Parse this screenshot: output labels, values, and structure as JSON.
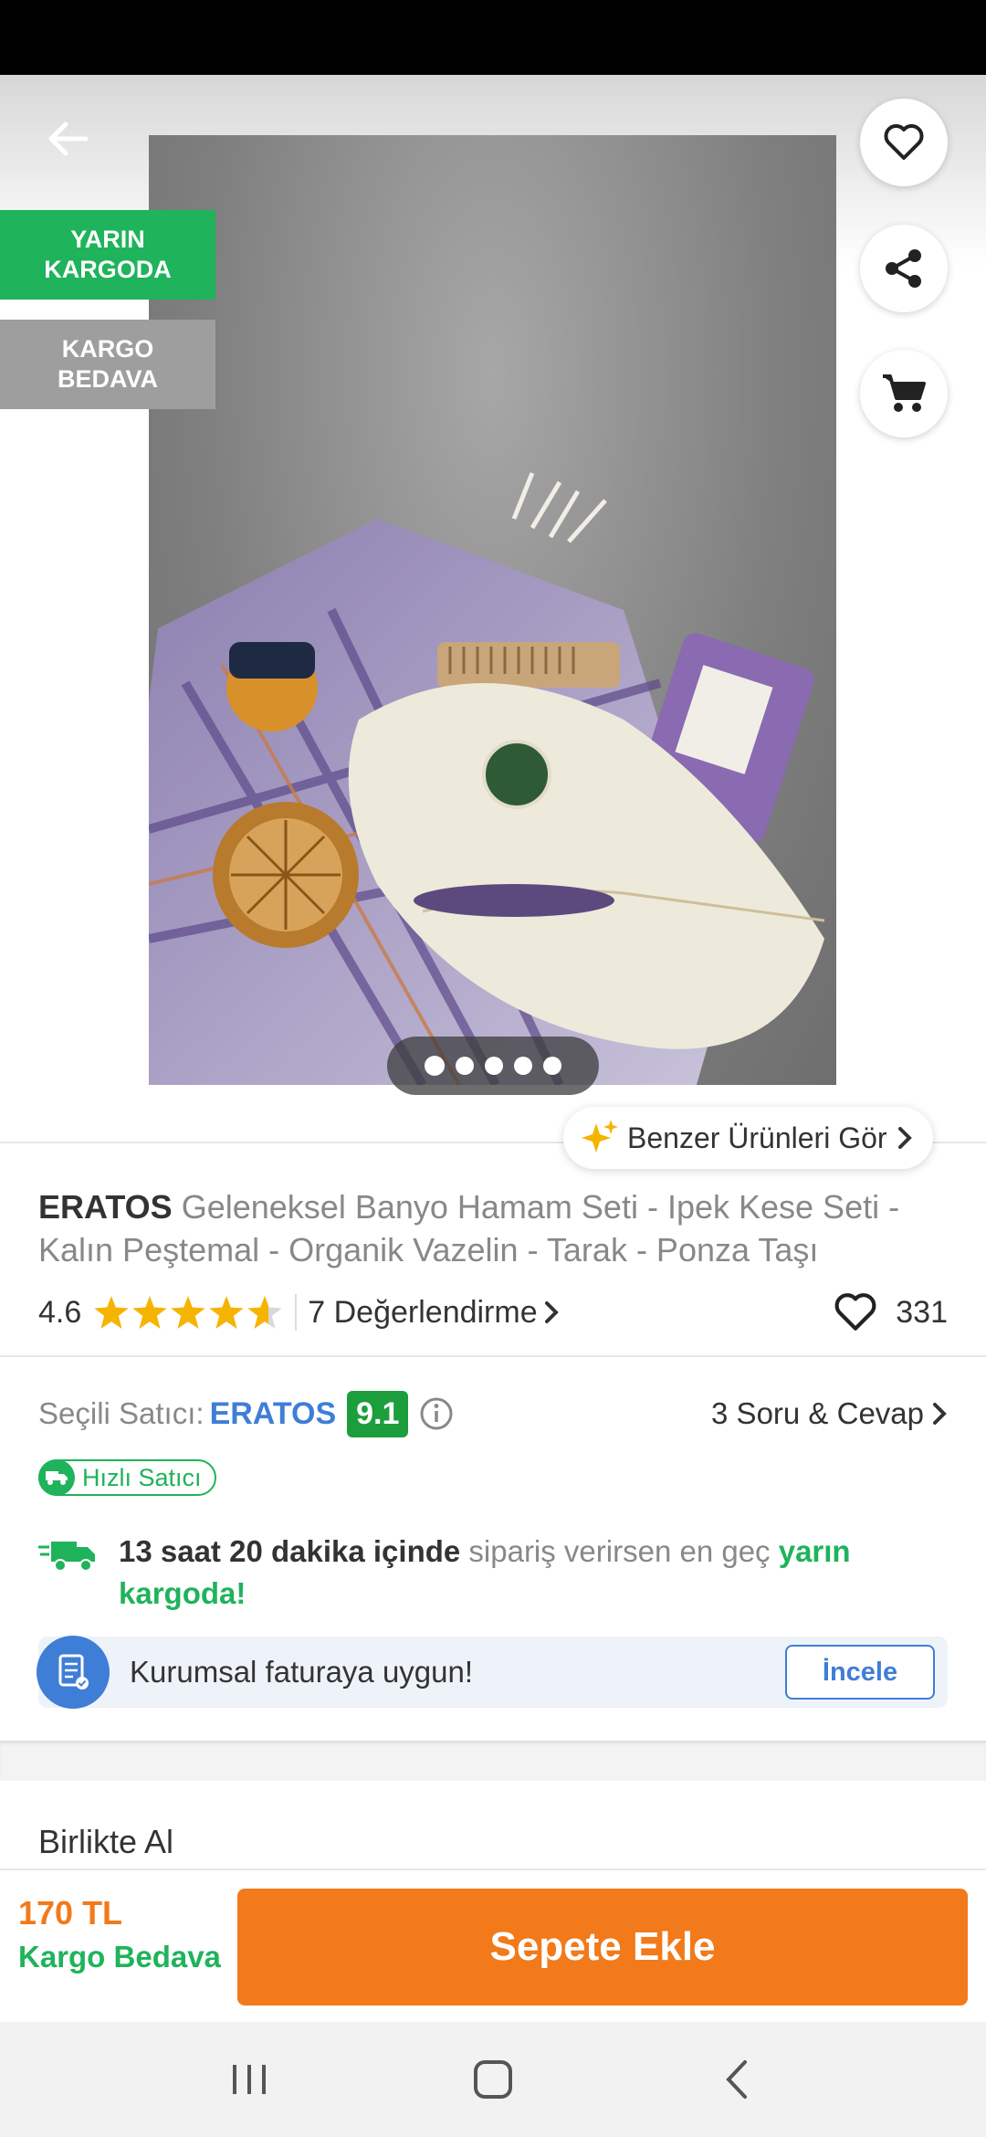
{
  "badges": {
    "next_day": [
      "YARIN",
      "KARGODA"
    ],
    "free_shipping": [
      "KARGO",
      "BEDAVA"
    ]
  },
  "gallery": {
    "image_count": 5,
    "active_index": 0
  },
  "similar_button": {
    "label": "Benzer Ürünleri Gör"
  },
  "product": {
    "brand": "ERATOS",
    "name": "Geleneksel Banyo Hamam Seti - Ipek Kese Seti - Kalın Peştemal - Organik Vazelin - Tarak - Ponza Taşı",
    "rating": "4.6",
    "rating_value": 4.6,
    "reviews_label": "7 Değerlendirme",
    "favorites": "331"
  },
  "seller": {
    "label": "Seçili Satıcı:",
    "name": "ERATOS",
    "score": "9.1",
    "qa_label": "3 Soru & Cevap",
    "fast_seller_label": "Hızlı Satıcı"
  },
  "delivery": {
    "time": "13 saat 20 dakika içinde",
    "middle": " sipariş verirsen en geç ",
    "highlight": "yarın kargoda!"
  },
  "invoice": {
    "text": "Kurumsal faturaya uygun!",
    "button": "İncele"
  },
  "section": {
    "together_title": "Birlikte Al"
  },
  "bottom_bar": {
    "price": "170 TL",
    "shipping": "Kargo Bedava",
    "add_to_cart": "Sepete Ekle"
  },
  "colors": {
    "accent_orange": "#f27a1a",
    "green": "#1fb35b",
    "blue": "#3f7ed6",
    "score_green": "#1c9e3d"
  }
}
